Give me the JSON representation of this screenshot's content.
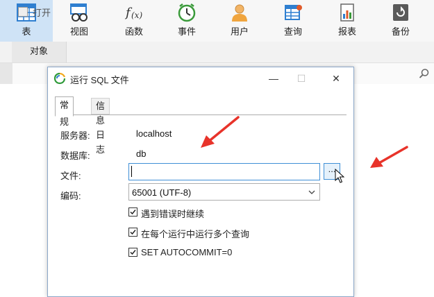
{
  "toolbar": {
    "items": [
      {
        "label": "表",
        "icon": "table-icon",
        "active": true
      },
      {
        "label": "视图",
        "icon": "view-icon",
        "active": false
      },
      {
        "label": "函数",
        "icon": "function-icon",
        "active": false
      },
      {
        "label": "事件",
        "icon": "clock-icon",
        "active": false
      },
      {
        "label": "用户",
        "icon": "user-icon",
        "active": false
      },
      {
        "label": "查询",
        "icon": "query-icon",
        "active": false
      },
      {
        "label": "报表",
        "icon": "report-icon",
        "active": false
      },
      {
        "label": "备份",
        "icon": "backup-icon",
        "active": false
      }
    ]
  },
  "object_tab": {
    "label": "对象"
  },
  "open_bar": {
    "label": "打开"
  },
  "dialog": {
    "title": "运行 SQL 文件",
    "minimize": "—",
    "maximize": "☐",
    "close": "✕",
    "tabs": [
      {
        "label": "常规",
        "active": true
      },
      {
        "label": "信息日志",
        "active": false
      }
    ],
    "server_label": "服务器:",
    "server_value": "localhost",
    "database_label": "数据库:",
    "database_value": "db",
    "file_label": "文件:",
    "file_value": "",
    "browse_label": "...",
    "encoding_label": "编码:",
    "encoding_value": "65001 (UTF-8)",
    "checkboxes": [
      {
        "label": "遇到错误时继续",
        "checked": true
      },
      {
        "label": "在每个运行中运行多个查询",
        "checked": true
      },
      {
        "label": "SET AUTOCOMMIT=0",
        "checked": true
      }
    ]
  },
  "colors": {
    "accent": "#3f8fd6",
    "active_tab_bg": "#cfe3f6",
    "annotation_arrow": "#e8332a"
  }
}
